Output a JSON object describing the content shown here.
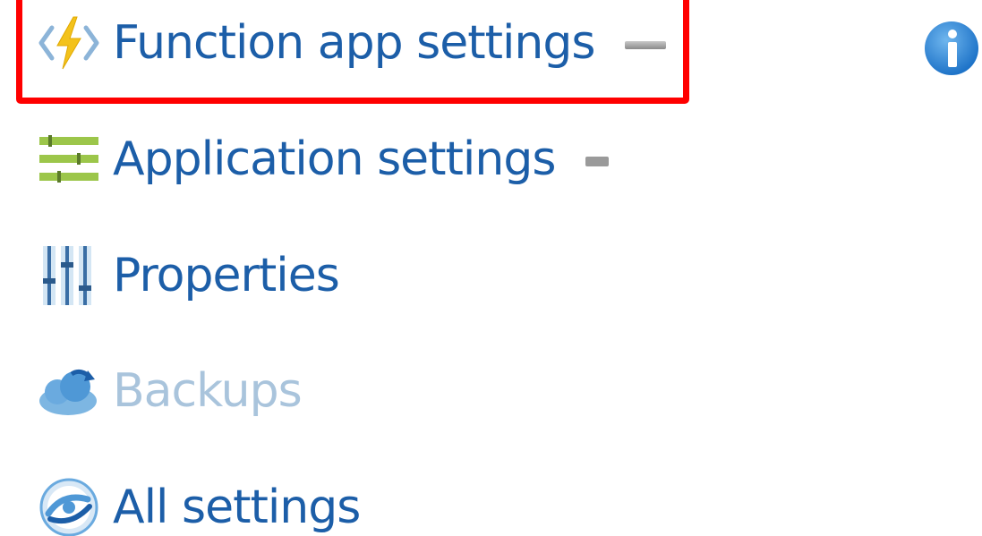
{
  "menu": {
    "items": [
      {
        "key": "function-app-settings",
        "label": "Function app settings",
        "icon": "function-app-icon",
        "highlighted": true,
        "pinned": true
      },
      {
        "key": "application-settings",
        "label": "Application settings",
        "icon": "application-settings-icon",
        "pinned": true
      },
      {
        "key": "properties",
        "label": "Properties",
        "icon": "properties-icon"
      },
      {
        "key": "backups",
        "label": "Backups",
        "icon": "backups-icon",
        "disabled": true
      },
      {
        "key": "all-settings",
        "label": "All settings",
        "icon": "all-settings-icon"
      }
    ]
  },
  "info": {
    "icon": "info-icon"
  },
  "colors": {
    "highlight": "#ff0000",
    "link": "#1c5ea8",
    "disabled": "#a9c4dc"
  }
}
